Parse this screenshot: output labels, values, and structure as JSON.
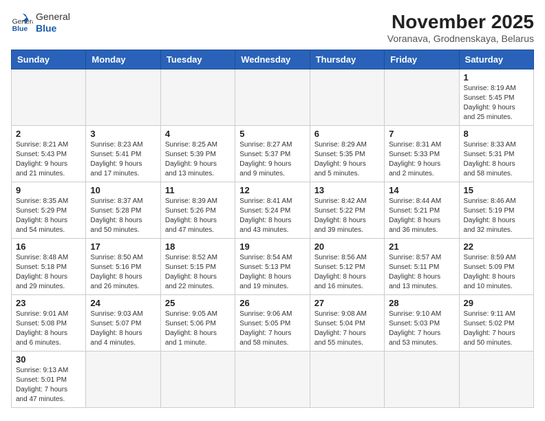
{
  "header": {
    "logo_line1": "General",
    "logo_line2": "Blue",
    "month_title": "November 2025",
    "location": "Voranava, Grodnenskaya, Belarus"
  },
  "weekdays": [
    "Sunday",
    "Monday",
    "Tuesday",
    "Wednesday",
    "Thursday",
    "Friday",
    "Saturday"
  ],
  "weeks": [
    [
      {
        "day": "",
        "info": ""
      },
      {
        "day": "",
        "info": ""
      },
      {
        "day": "",
        "info": ""
      },
      {
        "day": "",
        "info": ""
      },
      {
        "day": "",
        "info": ""
      },
      {
        "day": "",
        "info": ""
      },
      {
        "day": "1",
        "info": "Sunrise: 8:19 AM\nSunset: 5:45 PM\nDaylight: 9 hours\nand 25 minutes."
      }
    ],
    [
      {
        "day": "2",
        "info": "Sunrise: 8:21 AM\nSunset: 5:43 PM\nDaylight: 9 hours\nand 21 minutes."
      },
      {
        "day": "3",
        "info": "Sunrise: 8:23 AM\nSunset: 5:41 PM\nDaylight: 9 hours\nand 17 minutes."
      },
      {
        "day": "4",
        "info": "Sunrise: 8:25 AM\nSunset: 5:39 PM\nDaylight: 9 hours\nand 13 minutes."
      },
      {
        "day": "5",
        "info": "Sunrise: 8:27 AM\nSunset: 5:37 PM\nDaylight: 9 hours\nand 9 minutes."
      },
      {
        "day": "6",
        "info": "Sunrise: 8:29 AM\nSunset: 5:35 PM\nDaylight: 9 hours\nand 5 minutes."
      },
      {
        "day": "7",
        "info": "Sunrise: 8:31 AM\nSunset: 5:33 PM\nDaylight: 9 hours\nand 2 minutes."
      },
      {
        "day": "8",
        "info": "Sunrise: 8:33 AM\nSunset: 5:31 PM\nDaylight: 8 hours\nand 58 minutes."
      }
    ],
    [
      {
        "day": "9",
        "info": "Sunrise: 8:35 AM\nSunset: 5:29 PM\nDaylight: 8 hours\nand 54 minutes."
      },
      {
        "day": "10",
        "info": "Sunrise: 8:37 AM\nSunset: 5:28 PM\nDaylight: 8 hours\nand 50 minutes."
      },
      {
        "day": "11",
        "info": "Sunrise: 8:39 AM\nSunset: 5:26 PM\nDaylight: 8 hours\nand 47 minutes."
      },
      {
        "day": "12",
        "info": "Sunrise: 8:41 AM\nSunset: 5:24 PM\nDaylight: 8 hours\nand 43 minutes."
      },
      {
        "day": "13",
        "info": "Sunrise: 8:42 AM\nSunset: 5:22 PM\nDaylight: 8 hours\nand 39 minutes."
      },
      {
        "day": "14",
        "info": "Sunrise: 8:44 AM\nSunset: 5:21 PM\nDaylight: 8 hours\nand 36 minutes."
      },
      {
        "day": "15",
        "info": "Sunrise: 8:46 AM\nSunset: 5:19 PM\nDaylight: 8 hours\nand 32 minutes."
      }
    ],
    [
      {
        "day": "16",
        "info": "Sunrise: 8:48 AM\nSunset: 5:18 PM\nDaylight: 8 hours\nand 29 minutes."
      },
      {
        "day": "17",
        "info": "Sunrise: 8:50 AM\nSunset: 5:16 PM\nDaylight: 8 hours\nand 26 minutes."
      },
      {
        "day": "18",
        "info": "Sunrise: 8:52 AM\nSunset: 5:15 PM\nDaylight: 8 hours\nand 22 minutes."
      },
      {
        "day": "19",
        "info": "Sunrise: 8:54 AM\nSunset: 5:13 PM\nDaylight: 8 hours\nand 19 minutes."
      },
      {
        "day": "20",
        "info": "Sunrise: 8:56 AM\nSunset: 5:12 PM\nDaylight: 8 hours\nand 16 minutes."
      },
      {
        "day": "21",
        "info": "Sunrise: 8:57 AM\nSunset: 5:11 PM\nDaylight: 8 hours\nand 13 minutes."
      },
      {
        "day": "22",
        "info": "Sunrise: 8:59 AM\nSunset: 5:09 PM\nDaylight: 8 hours\nand 10 minutes."
      }
    ],
    [
      {
        "day": "23",
        "info": "Sunrise: 9:01 AM\nSunset: 5:08 PM\nDaylight: 8 hours\nand 6 minutes."
      },
      {
        "day": "24",
        "info": "Sunrise: 9:03 AM\nSunset: 5:07 PM\nDaylight: 8 hours\nand 4 minutes."
      },
      {
        "day": "25",
        "info": "Sunrise: 9:05 AM\nSunset: 5:06 PM\nDaylight: 8 hours\nand 1 minute."
      },
      {
        "day": "26",
        "info": "Sunrise: 9:06 AM\nSunset: 5:05 PM\nDaylight: 7 hours\nand 58 minutes."
      },
      {
        "day": "27",
        "info": "Sunrise: 9:08 AM\nSunset: 5:04 PM\nDaylight: 7 hours\nand 55 minutes."
      },
      {
        "day": "28",
        "info": "Sunrise: 9:10 AM\nSunset: 5:03 PM\nDaylight: 7 hours\nand 53 minutes."
      },
      {
        "day": "29",
        "info": "Sunrise: 9:11 AM\nSunset: 5:02 PM\nDaylight: 7 hours\nand 50 minutes."
      }
    ],
    [
      {
        "day": "30",
        "info": "Sunrise: 9:13 AM\nSunset: 5:01 PM\nDaylight: 7 hours\nand 47 minutes."
      },
      {
        "day": "",
        "info": ""
      },
      {
        "day": "",
        "info": ""
      },
      {
        "day": "",
        "info": ""
      },
      {
        "day": "",
        "info": ""
      },
      {
        "day": "",
        "info": ""
      },
      {
        "day": "",
        "info": ""
      }
    ]
  ]
}
